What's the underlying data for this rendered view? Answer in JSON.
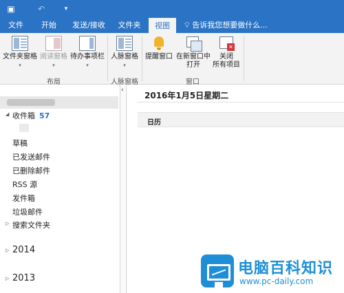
{
  "qat": {
    "app_icon": "outlook-app-icon",
    "undo_icon": "undo-icon",
    "customize_icon": "customize-qat-icon"
  },
  "tabs": [
    {
      "label": "文件"
    },
    {
      "label": "开始"
    },
    {
      "label": "发送/接收"
    },
    {
      "label": "文件夹"
    },
    {
      "label": "视图"
    }
  ],
  "active_tab": "视图",
  "tell_me": "告诉我您想要做什么...",
  "ribbon": {
    "layout_group": {
      "label": "布局",
      "folder_pane": "文件夹窗格",
      "reading_pane": "阅读窗格",
      "todo_bar": "待办事项栏"
    },
    "people_group": {
      "label": "人脉窗格",
      "people_pane": "人脉窗格"
    },
    "window_group": {
      "label": "窗口",
      "reminder": "提醒窗口",
      "open_new_line1": "在新窗口中",
      "open_new_line2": "打开",
      "close_all_line1": "关闭",
      "close_all_line2": "所有项目"
    }
  },
  "folders": {
    "inbox": {
      "label": "收件箱",
      "count": "57"
    },
    "items": [
      {
        "label": "草稿"
      },
      {
        "label": "已发送邮件"
      },
      {
        "label": "已删除邮件"
      },
      {
        "label": "RSS 源"
      },
      {
        "label": "发件箱"
      },
      {
        "label": "垃圾邮件"
      },
      {
        "label": "搜索文件夹"
      }
    ],
    "years": [
      {
        "label": "2014"
      },
      {
        "label": "2013"
      }
    ]
  },
  "main": {
    "date": "2016年1月5日星期二",
    "calendar_header": "日历"
  },
  "watermark": {
    "title": "电脑百科知识",
    "url": "www.pc-daily.com"
  },
  "colors": {
    "accent": "#2b73c4",
    "ribbon_bg": "#f3f3f3",
    "watermark": "#1e8fd6"
  }
}
